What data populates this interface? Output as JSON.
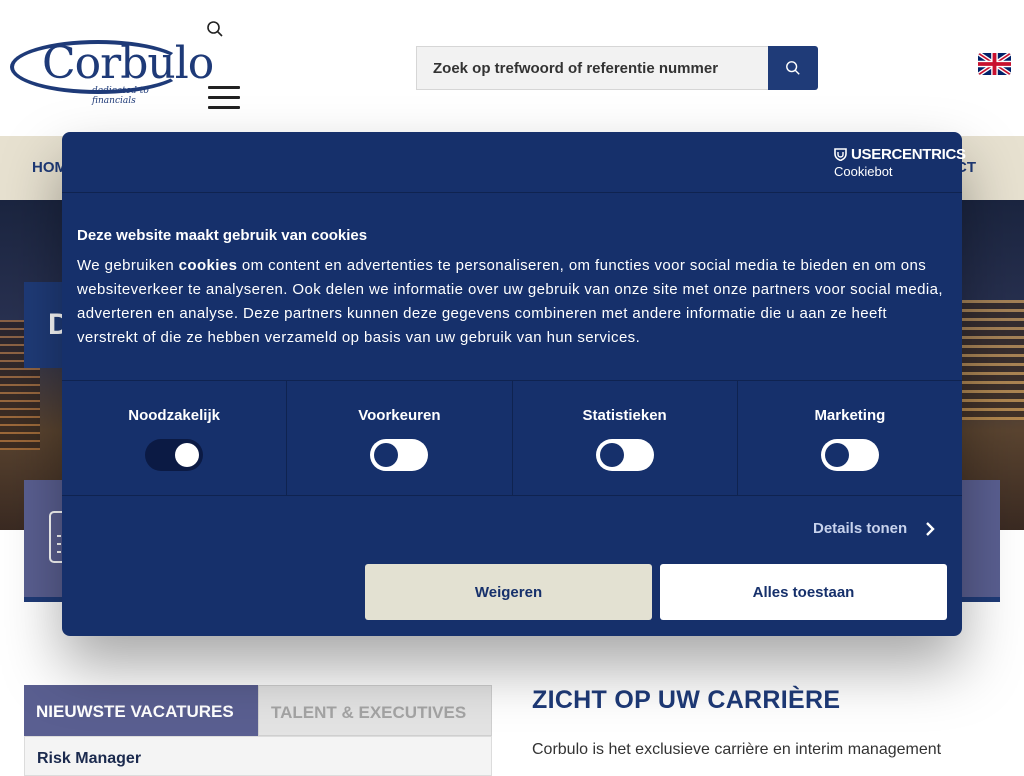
{
  "brand": {
    "name": "Corbulo",
    "tagline": "dedicated to financials"
  },
  "header": {
    "search_placeholder": "Zoek op trefwoord of referentie nummer",
    "search_icon": "search-icon",
    "language_flag": "uk-flag-icon"
  },
  "nav": {
    "first_item": "HOM",
    "last_item": "CT"
  },
  "hero": {
    "panel_letter": "D"
  },
  "tabs": {
    "vacancies": "NIEUWSTE VACATURES",
    "talent": "TALENT & EXECUTIVES"
  },
  "jobs": [
    {
      "title": "Risk Manager"
    }
  ],
  "intro": {
    "title": "ZICHT OP UW CARRIÈRE",
    "text": "Corbulo is het exclusieve carrière en interim management"
  },
  "cookie_dialog": {
    "provider_title": "USERCENTRICS",
    "provider_sub": "Cookiebot",
    "heading": "Deze website maakt gebruik van cookies",
    "body_prefix": "We gebruiken ",
    "body_link": "cookies",
    "body_rest": " om content en advertenties te personaliseren, om functies voor social media te bieden en om ons websiteverkeer te analyseren. Ook delen we informatie over uw gebruik van onze site met onze partners voor social media, adverteren en analyse. Deze partners kunnen deze gegevens combineren met andere informatie die u aan ze heeft verstrekt of die ze hebben verzameld op basis van uw gebruik van hun services.",
    "categories": [
      {
        "label": "Noodzakelijk",
        "enabled": true
      },
      {
        "label": "Voorkeuren",
        "enabled": false
      },
      {
        "label": "Statistieken",
        "enabled": false
      },
      {
        "label": "Marketing",
        "enabled": false
      }
    ],
    "details_label": "Details tonen",
    "deny_label": "Weigeren",
    "allow_label": "Alles toestaan"
  },
  "colors": {
    "brand_blue": "#1e3a78",
    "dialog_bg": "#16306b",
    "nav_bg": "#e7e1d0",
    "tab_active": "#5a5f91"
  }
}
